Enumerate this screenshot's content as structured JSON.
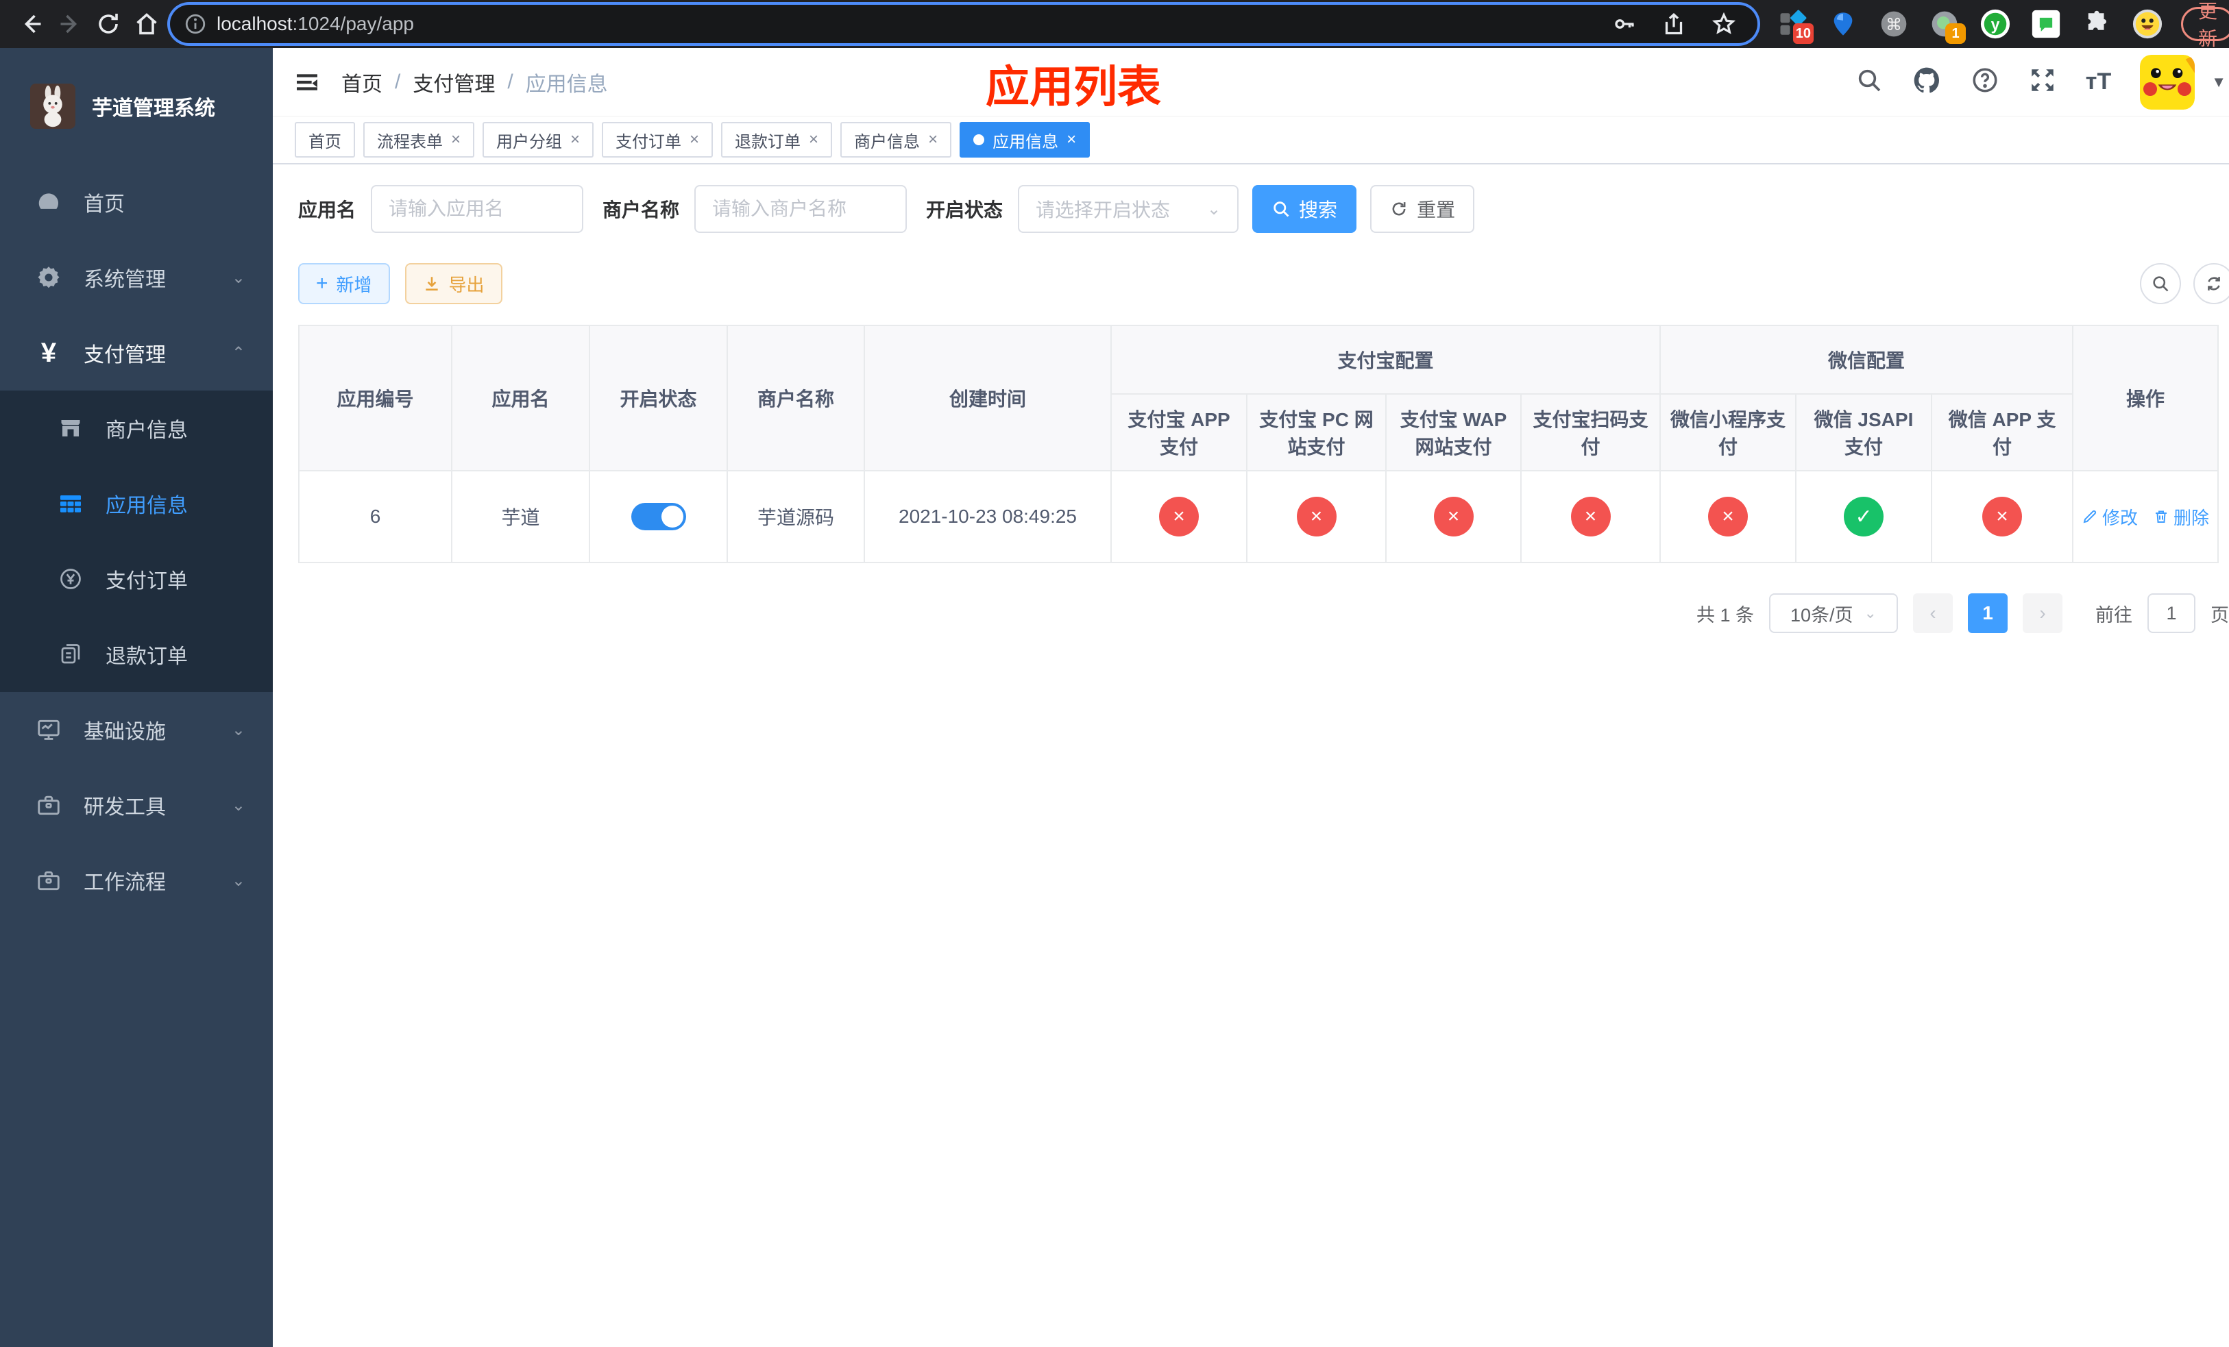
{
  "browser": {
    "url_host": "localhost",
    "url_rest": ":1024/pay/app",
    "update_label": "更新",
    "ext_badge_primary": "10",
    "ext_badge_secondary": "1"
  },
  "sidebar": {
    "title": "芋道管理系统",
    "items": {
      "home": "首页",
      "system": "系统管理",
      "pay": "支付管理",
      "merchant": "商户信息",
      "appinfo": "应用信息",
      "payorder": "支付订单",
      "refund": "退款订单",
      "infra": "基础设施",
      "devtool": "研发工具",
      "workflow": "工作流程"
    }
  },
  "navbar": {
    "breadcrumb": [
      "首页",
      "支付管理",
      "应用信息"
    ],
    "annotation": "应用列表"
  },
  "tabs": [
    {
      "label": "首页"
    },
    {
      "label": "流程表单"
    },
    {
      "label": "用户分组"
    },
    {
      "label": "支付订单"
    },
    {
      "label": "退款订单"
    },
    {
      "label": "商户信息"
    },
    {
      "label": "应用信息"
    }
  ],
  "filters": {
    "app_name_label": "应用名",
    "app_name_placeholder": "请输入应用名",
    "merchant_label": "商户名称",
    "merchant_placeholder": "请输入商户名称",
    "status_label": "开启状态",
    "status_placeholder": "请选择开启状态",
    "search_label": "搜索",
    "reset_label": "重置"
  },
  "toolbar": {
    "add_label": "新增",
    "export_label": "导出"
  },
  "table": {
    "headers": {
      "app_id": "应用编号",
      "app_name": "应用名",
      "status": "开启状态",
      "merchant": "商户名称",
      "created": "创建时间",
      "alipay_group": "支付宝配置",
      "wechat_group": "微信配置",
      "operation": "操作",
      "alipay_cols": [
        "支付宝 APP 支付",
        "支付宝 PC 网站支付",
        "支付宝 WAP 网站支付",
        "支付宝扫码支付"
      ],
      "wechat_cols": [
        "微信小程序支付",
        "微信 JSAPI 支付",
        "微信 APP 支付"
      ]
    },
    "row": {
      "app_id": "6",
      "app_name": "芋道",
      "enabled": true,
      "merchant": "芋道源码",
      "created": "2021-10-23 08:49:25",
      "channel_statuses": [
        "disabled",
        "disabled",
        "disabled",
        "disabled",
        "disabled",
        "enabled",
        "disabled"
      ],
      "edit_label": "修改",
      "delete_label": "删除"
    }
  },
  "pagination": {
    "total_label": "共 1 条",
    "page_size_label": "10条/页",
    "current_page": "1",
    "goto_label": "前往",
    "goto_value": "1",
    "page_unit": "页"
  }
}
